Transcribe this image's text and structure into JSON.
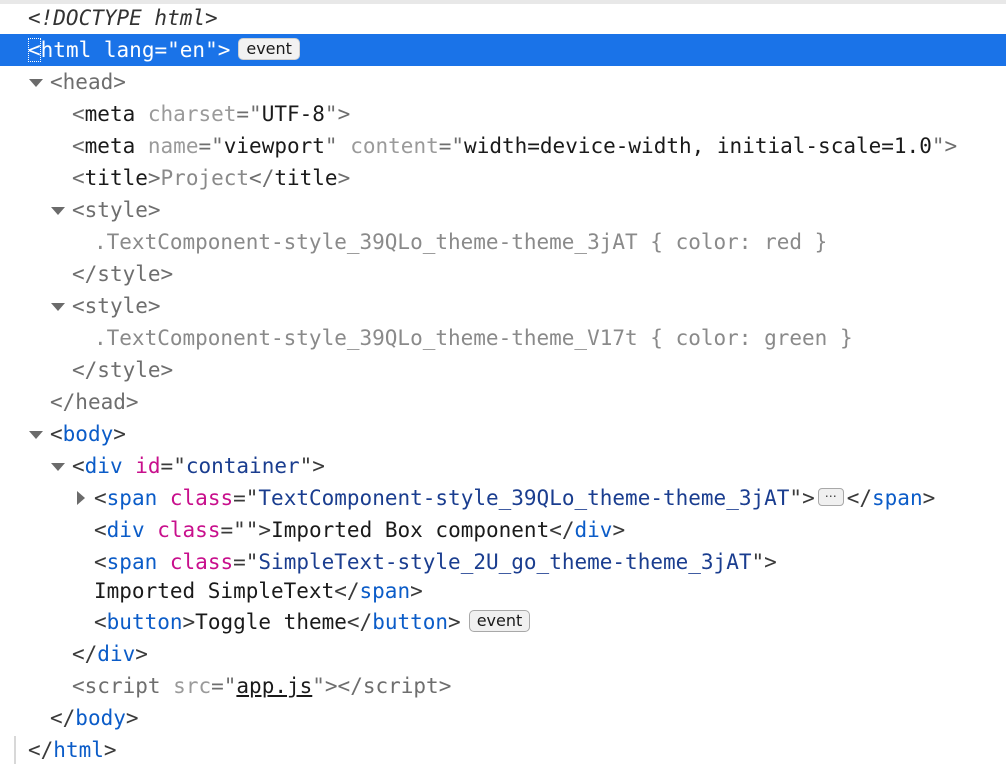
{
  "badges": {
    "event": "event",
    "ellipsis": "⋯"
  },
  "lines": {
    "doctype": "<!DOCTYPE html>",
    "html_open": {
      "tag": "html",
      "attr": "lang",
      "value": "en"
    },
    "head_open": "head",
    "meta_charset": {
      "tag": "meta",
      "attr": "charset",
      "value": "UTF-8"
    },
    "meta_viewport": {
      "tag": "meta",
      "attr1": "name",
      "value1": "viewport",
      "attr2": "content",
      "value2": "width=device-width, initial-scale=1.0"
    },
    "title": {
      "tag": "title",
      "text": "Project"
    },
    "style1_css": ".TextComponent-style_39QLo_theme-theme_3jAT { color: red }",
    "style2_css": ".TextComponent-style_39QLo_theme-theme_V17t { color: green }",
    "style_tag": "style",
    "head_tag": "head",
    "body_tag": "body",
    "div_container": {
      "tag": "div",
      "attr": "id",
      "value": "container"
    },
    "span1": {
      "tag": "span",
      "attr": "class",
      "value": "TextComponent-style_39QLo_theme-theme_3jAT"
    },
    "div_box": {
      "tag": "div",
      "attr": "class",
      "value": "",
      "text": "Imported Box component"
    },
    "span2": {
      "tag": "span",
      "attr": "class",
      "value": "SimpleText-style_2U_go_theme-theme_3jAT"
    },
    "span2_text": "Imported SimpleText",
    "button": {
      "tag": "button",
      "text": "Toggle theme"
    },
    "div_close": "div",
    "script": {
      "tag": "script",
      "attr": "src",
      "value": "app.js"
    },
    "body_close": "body",
    "html_close": "html"
  },
  "colors": {
    "selection": "#1a73e8",
    "tag": "#0b5cc8",
    "attr": "#c80f8c",
    "value": "#1a3d8f"
  }
}
